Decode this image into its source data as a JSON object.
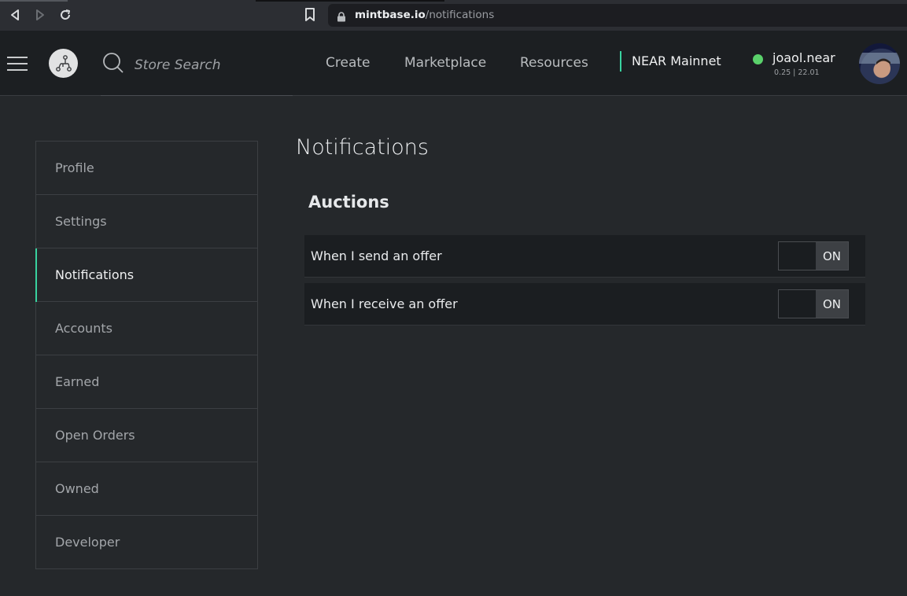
{
  "browser": {
    "url_domain": "mintbase.io",
    "url_path": "/notifications"
  },
  "header": {
    "search_placeholder": "Store Search",
    "nav": [
      "Create",
      "Marketplace",
      "Resources"
    ],
    "network": "NEAR Mainnet",
    "account_name": "joaol.near",
    "account_balance": "0.25 | 22.01",
    "status_color": "#5ad16b",
    "accent_color": "#39d3a0"
  },
  "sidebar": {
    "items": [
      {
        "label": "Profile"
      },
      {
        "label": "Settings"
      },
      {
        "label": "Notifications",
        "active": true
      },
      {
        "label": "Accounts"
      },
      {
        "label": "Earned"
      },
      {
        "label": "Open Orders"
      },
      {
        "label": "Owned"
      },
      {
        "label": "Developer"
      }
    ]
  },
  "main": {
    "title": "Notifications",
    "section": "Auctions",
    "settings": [
      {
        "label": "When I send an offer",
        "toggle": "ON"
      },
      {
        "label": "When I receive an offer",
        "toggle": "ON"
      }
    ]
  }
}
